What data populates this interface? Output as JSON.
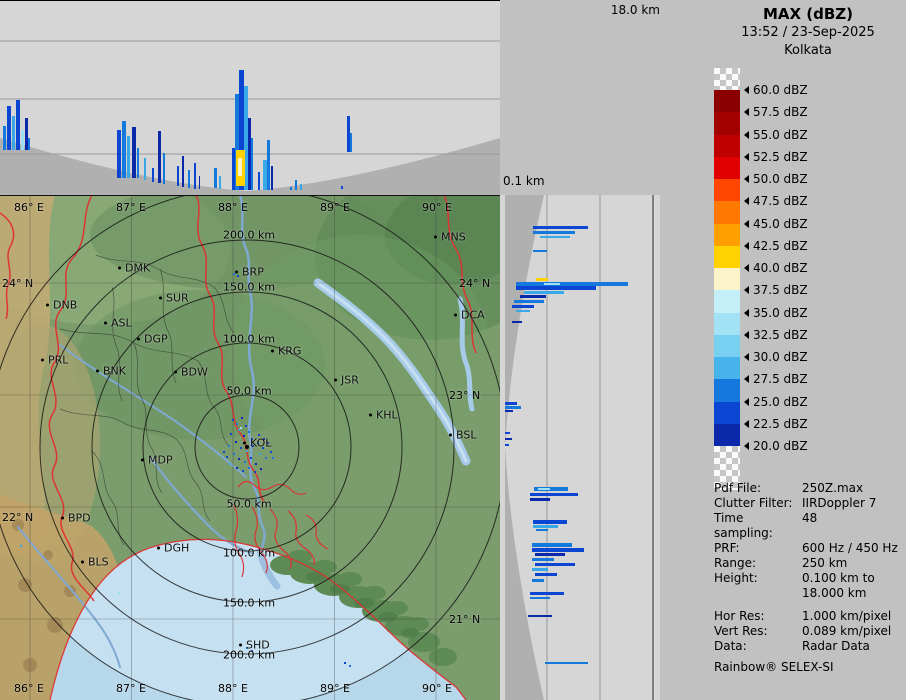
{
  "header": {
    "title": "MAX (dBZ)",
    "datetime": "13:52 / 23-Sep-2025",
    "site": "Kolkata"
  },
  "axis": {
    "max_height": "18.0 km",
    "min_height": "0.1 km"
  },
  "legend": {
    "labels": [
      "60.0 dBZ",
      "57.5 dBZ",
      "55.0 dBZ",
      "52.5 dBZ",
      "50.0 dBZ",
      "47.5 dBZ",
      "45.0 dBZ",
      "42.5 dBZ",
      "40.0 dBZ",
      "37.5 dBZ",
      "35.0 dBZ",
      "32.5 dBZ",
      "30.0 dBZ",
      "27.5 dBZ",
      "25.0 dBZ",
      "22.5 dBZ",
      "20.0 dBZ"
    ],
    "block_colors": [
      "#8a0000",
      "#a30000",
      "#c00000",
      "#e00000",
      "#ff4600",
      "#ff7800",
      "#ffa000",
      "#ffd200",
      "#fdf3c8",
      "#c4eef8",
      "#a2e2f4",
      "#78d0f0",
      "#46b4ea",
      "#1478dc",
      "#0a46d2",
      "#0a28aa"
    ]
  },
  "info": {
    "rows": [
      {
        "label": "Pdf File:",
        "value": "250Z.max"
      },
      {
        "label": "Clutter Filter:",
        "value": "IIRDoppler 7"
      },
      {
        "label": "Time sampling:",
        "value": "48"
      },
      {
        "label": "PRF:",
        "value": "600 Hz / 450 Hz"
      },
      {
        "label": "Range:",
        "value": "250 km"
      },
      {
        "label": "Height:",
        "value": "0.100 km to"
      },
      {
        "label": "",
        "value": "18.000 km"
      },
      {
        "label": "Hor Res:",
        "value": "1.000 km/pixel",
        "gap": true
      },
      {
        "label": "Vert Res:",
        "value": "0.089 km/pixel"
      },
      {
        "label": "Data:",
        "value": "Radar Data"
      }
    ],
    "brand": "Rainbow® SELEX-SI"
  },
  "map": {
    "lon_labels": [
      [
        "86° E",
        14
      ],
      [
        "87° E",
        116
      ],
      [
        "88° E",
        218
      ],
      [
        "89° E",
        320
      ],
      [
        "90° E",
        422
      ]
    ],
    "lat_labels": [
      [
        "24° N",
        2,
        82
      ],
      [
        "22° N",
        2,
        316
      ],
      [
        "24° N",
        459,
        82
      ],
      [
        "23° N",
        449,
        194
      ],
      [
        "21° N",
        449,
        418
      ]
    ],
    "ring_labels": [
      [
        "200.0 km",
        249,
        40
      ],
      [
        "150.0 km",
        249,
        92
      ],
      [
        "100.0 km",
        249,
        144
      ],
      [
        "50.0 km",
        249,
        196
      ],
      [
        "50.0 km",
        249,
        309
      ],
      [
        "100.0 km",
        249,
        358
      ],
      [
        "150.0 km",
        249,
        408
      ],
      [
        "200.0 km",
        249,
        460
      ]
    ],
    "cities": [
      [
        "DMK",
        118,
        73
      ],
      [
        "BRP",
        235,
        77
      ],
      [
        "SUR",
        159,
        103
      ],
      [
        "DNB",
        46,
        110
      ],
      [
        "ASL",
        104,
        128
      ],
      [
        "DGP",
        137,
        144
      ],
      [
        "PRL",
        41,
        165
      ],
      [
        "BNK",
        96,
        176
      ],
      [
        "BDW",
        174,
        177
      ],
      [
        "KRG",
        271,
        156
      ],
      [
        "JSR",
        334,
        185
      ],
      [
        "KHL",
        369,
        220
      ],
      [
        "BSL",
        449,
        240
      ],
      [
        "DCA",
        454,
        120
      ],
      [
        "MNS",
        434,
        42
      ],
      [
        "KOL",
        243,
        248
      ],
      [
        "MDP",
        141,
        265
      ],
      [
        "BPD",
        61,
        323
      ],
      [
        "DGH",
        157,
        353
      ],
      [
        "BLS",
        81,
        367
      ],
      [
        "SHD",
        239,
        450
      ]
    ]
  },
  "chart_data": {
    "type": "radar_max_reflectivity_composite",
    "product": "MAX (dBZ)",
    "site": "Kolkata",
    "timestamp": "13:52 / 23-Sep-2025",
    "dbz_scale": {
      "min": 20.0,
      "max": 60.0,
      "step": 2.5
    },
    "range_km": 250,
    "ring_interval_km": 50,
    "height_axis_km": {
      "min": 0.1,
      "max": 18.0
    },
    "ew_projection_bars": [
      [
        3,
        126,
        3,
        24,
        "#1478dc"
      ],
      [
        7,
        106,
        4,
        44,
        "#0a46d2"
      ],
      [
        12,
        116,
        3,
        34,
        "#38a8e8"
      ],
      [
        16,
        100,
        4,
        50,
        "#0a46d2"
      ],
      [
        21,
        130,
        3,
        20,
        "#a0e0f5"
      ],
      [
        25,
        118,
        3,
        32,
        "#0a28aa"
      ],
      [
        28,
        138,
        2,
        12,
        "#1478dc"
      ],
      [
        117,
        130,
        4,
        48,
        "#0a46d2"
      ],
      [
        122,
        121,
        4,
        57,
        "#1478dc"
      ],
      [
        127,
        136,
        3,
        42,
        "#38a8e8"
      ],
      [
        132,
        127,
        4,
        51,
        "#0a28aa"
      ],
      [
        137,
        148,
        2,
        30,
        "#1478dc"
      ],
      [
        144,
        158,
        2,
        22,
        "#38a8e8"
      ],
      [
        152,
        168,
        2,
        14,
        "#0a46d2"
      ],
      [
        158,
        131,
        3,
        52,
        "#0a28aa"
      ],
      [
        163,
        153,
        2,
        31,
        "#1478dc"
      ],
      [
        177,
        166,
        2,
        20,
        "#0a46d2"
      ],
      [
        182,
        156,
        2,
        31,
        "#0a28aa"
      ],
      [
        188,
        170,
        2,
        18,
        "#1478dc"
      ],
      [
        194,
        163,
        2,
        26,
        "#0a46d2"
      ],
      [
        199,
        176,
        1,
        13,
        "#0a28aa"
      ],
      [
        214,
        168,
        3,
        20,
        "#1478dc"
      ],
      [
        219,
        176,
        2,
        13,
        "#38a8e8"
      ],
      [
        232,
        148,
        3,
        42,
        "#0a46d2"
      ],
      [
        235,
        94,
        4,
        96,
        "#1478dc"
      ],
      [
        239,
        70,
        5,
        120,
        "#0a46d2"
      ],
      [
        244,
        86,
        4,
        104,
        "#38a8e8"
      ],
      [
        248,
        118,
        3,
        72,
        "#0a28aa"
      ],
      [
        251,
        138,
        2,
        52,
        "#1478dc"
      ],
      [
        236,
        150,
        9,
        36,
        "#ffd200"
      ],
      [
        238,
        158,
        4,
        18,
        "#fdf3c8"
      ],
      [
        258,
        172,
        2,
        18,
        "#0a46d2"
      ],
      [
        263,
        160,
        4,
        30,
        "#38a8e8"
      ],
      [
        267,
        140,
        3,
        50,
        "#1478dc"
      ],
      [
        271,
        166,
        2,
        24,
        "#0a28aa"
      ],
      [
        290,
        187,
        2,
        3,
        "#1478dc"
      ],
      [
        295,
        180,
        2,
        10,
        "#1478dc"
      ],
      [
        300,
        184,
        2,
        6,
        "#38a8e8"
      ],
      [
        341,
        186,
        2,
        3,
        "#0a46d2"
      ],
      [
        347,
        116,
        3,
        36,
        "#0a46d2"
      ],
      [
        350,
        133,
        2,
        19,
        "#1478dc"
      ]
    ],
    "ns_projection_bars": [
      [
        33,
        31,
        55,
        3,
        "#0a46d2"
      ],
      [
        33,
        36,
        42,
        3,
        "#1478dc"
      ],
      [
        40,
        41,
        30,
        2,
        "#38a8e8"
      ],
      [
        33,
        55,
        14,
        2,
        "#1478dc"
      ],
      [
        36,
        83,
        12,
        3,
        "#ffd200"
      ],
      [
        16,
        87,
        112,
        4,
        "#1478dc"
      ],
      [
        44,
        88,
        16,
        2,
        "#a0e0f5"
      ],
      [
        16,
        91,
        80,
        4,
        "#0a46d2"
      ],
      [
        24,
        96,
        40,
        3,
        "#38a8e8"
      ],
      [
        20,
        100,
        26,
        3,
        "#0a28aa"
      ],
      [
        14,
        105,
        30,
        3,
        "#1478dc"
      ],
      [
        12,
        110,
        22,
        3,
        "#0a46d2"
      ],
      [
        16,
        115,
        14,
        2,
        "#38a8e8"
      ],
      [
        12,
        126,
        10,
        2,
        "#0a28aa"
      ],
      [
        5,
        207,
        12,
        3,
        "#0a46d2"
      ],
      [
        5,
        211,
        16,
        3,
        "#1478dc"
      ],
      [
        5,
        215,
        8,
        2,
        "#0a28aa"
      ],
      [
        5,
        237,
        5,
        2,
        "#0a46d2"
      ],
      [
        5,
        243,
        7,
        2,
        "#0a28aa"
      ],
      [
        5,
        249,
        4,
        2,
        "#0a46d2"
      ],
      [
        34,
        292,
        34,
        4,
        "#1478dc"
      ],
      [
        38,
        293,
        12,
        2,
        "#a0e0f5"
      ],
      [
        30,
        298,
        48,
        3,
        "#0a46d2"
      ],
      [
        30,
        303,
        20,
        3,
        "#0a28aa"
      ],
      [
        33,
        325,
        34,
        4,
        "#0a46d2"
      ],
      [
        33,
        330,
        25,
        3,
        "#38a8e8"
      ],
      [
        36,
        334,
        12,
        2,
        "#1478dc"
      ],
      [
        32,
        348,
        40,
        4,
        "#1478dc"
      ],
      [
        32,
        353,
        52,
        4,
        "#0a46d2"
      ],
      [
        35,
        358,
        30,
        3,
        "#0a28aa"
      ],
      [
        32,
        363,
        22,
        3,
        "#1478dc"
      ],
      [
        35,
        368,
        40,
        3,
        "#0a46d2"
      ],
      [
        32,
        373,
        16,
        3,
        "#38a8e8"
      ],
      [
        35,
        378,
        22,
        3,
        "#0a46d2"
      ],
      [
        32,
        384,
        12,
        3,
        "#1478dc"
      ],
      [
        30,
        397,
        34,
        3,
        "#0a46d2"
      ],
      [
        30,
        402,
        20,
        2,
        "#1478dc"
      ],
      [
        28,
        420,
        24,
        2,
        "#0a28aa"
      ],
      [
        45,
        467,
        43,
        2,
        "#1478dc"
      ]
    ],
    "map_echo_pixels": [
      [
        232,
        224,
        "#0a46d2"
      ],
      [
        236,
        228,
        "#1478dc"
      ],
      [
        241,
        222,
        "#0a28aa"
      ],
      [
        245,
        230,
        "#0a46d2"
      ],
      [
        238,
        234,
        "#38a8e8"
      ],
      [
        230,
        238,
        "#0a46d2"
      ],
      [
        243,
        240,
        "#0a28aa"
      ],
      [
        248,
        236,
        "#1478dc"
      ],
      [
        251,
        243,
        "#0a46d2"
      ],
      [
        235,
        246,
        "#0a28aa"
      ],
      [
        228,
        250,
        "#1478dc"
      ],
      [
        240,
        252,
        "#0a46d2"
      ],
      [
        246,
        255,
        "#38a8e8"
      ],
      [
        252,
        250,
        "#0a28aa"
      ],
      [
        257,
        247,
        "#0a46d2"
      ],
      [
        233,
        258,
        "#1478dc"
      ],
      [
        226,
        261,
        "#0a46d2"
      ],
      [
        238,
        263,
        "#0a28aa"
      ],
      [
        244,
        266,
        "#1478dc"
      ],
      [
        250,
        262,
        "#0a46d2"
      ],
      [
        255,
        268,
        "#0a28aa"
      ],
      [
        259,
        258,
        "#38a8e8"
      ],
      [
        262,
        252,
        "#0a46d2"
      ],
      [
        265,
        262,
        "#1478dc"
      ],
      [
        270,
        256,
        "#0a46d2"
      ],
      [
        236,
        272,
        "#0a28aa"
      ],
      [
        242,
        275,
        "#0a46d2"
      ],
      [
        248,
        272,
        "#1478dc"
      ],
      [
        254,
        276,
        "#0a46d2"
      ],
      [
        260,
        273,
        "#0a28aa"
      ],
      [
        229,
        268,
        "#38a8e8"
      ],
      [
        223,
        256,
        "#0a46d2"
      ],
      [
        267,
        247,
        "#0a28aa"
      ],
      [
        272,
        262,
        "#1478dc"
      ],
      [
        258,
        239,
        "#0a46d2"
      ],
      [
        263,
        243,
        "#0a28aa"
      ],
      [
        240,
        232,
        "#a0e0f5"
      ],
      [
        233,
        78,
        "#1478dc"
      ],
      [
        237,
        80,
        "#0a46d2"
      ],
      [
        246,
        452,
        "#1478dc"
      ],
      [
        251,
        455,
        "#0a46d2"
      ],
      [
        344,
        467,
        "#0a46d2"
      ],
      [
        349,
        470,
        "#1478dc"
      ],
      [
        118,
        397,
        "#a0e0f5"
      ],
      [
        20,
        350,
        "#38a8e8"
      ]
    ]
  }
}
